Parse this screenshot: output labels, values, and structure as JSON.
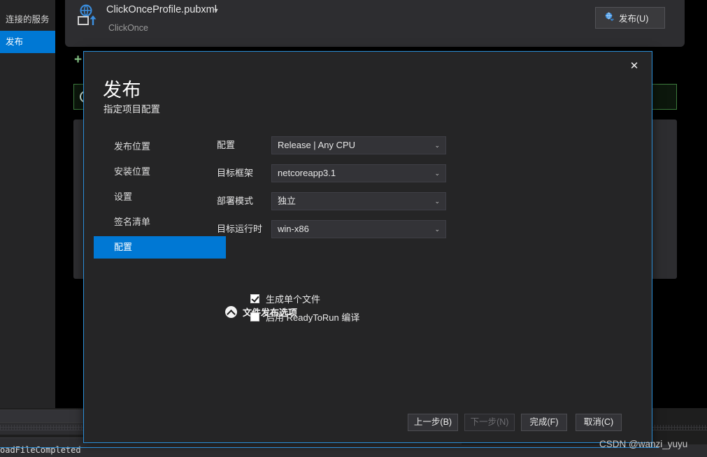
{
  "sidebar": {
    "items": [
      {
        "label": "连接的服务",
        "selected": false
      },
      {
        "label": "发布",
        "selected": true
      }
    ]
  },
  "toolbar": {
    "profile_name": "ClickOnceProfile.pubxml",
    "profile_type": "ClickOnce",
    "caret_glyph": "▼",
    "publish_button": "发布(U)"
  },
  "dialog": {
    "title": "发布",
    "subtitle": "指定项目配置",
    "close_glyph": "✕",
    "steps": [
      {
        "label": "发布位置"
      },
      {
        "label": "安装位置"
      },
      {
        "label": "设置"
      },
      {
        "label": "签名清单"
      },
      {
        "label": "配置"
      }
    ],
    "active_step_index": 4,
    "fields": [
      {
        "label": "配置",
        "value": "Release | Any CPU",
        "chevron": "⌄"
      },
      {
        "label": "目标框架",
        "value": "netcoreapp3.1",
        "chevron": "⌄"
      },
      {
        "label": "部署模式",
        "value": "独立",
        "chevron": "⌄"
      },
      {
        "label": "目标运行时",
        "value": "win-x86",
        "chevron": "⌄"
      }
    ],
    "expander": {
      "label": "文件发布选项",
      "expanded": true
    },
    "checkboxes": [
      {
        "label": "生成单个文件",
        "checked": true
      },
      {
        "label": "启用 ReadyToRun 编译",
        "checked": false
      }
    ],
    "buttons": [
      {
        "label": "上一步(B)",
        "disabled": false
      },
      {
        "label": "下一步(N)",
        "disabled": true
      },
      {
        "label": "完成(F)",
        "disabled": false
      },
      {
        "label": "取消(C)",
        "disabled": false
      }
    ]
  },
  "status": {
    "text": "oadFileCompleted"
  },
  "watermark": {
    "text": "CSDN @wanzi_yuyu"
  },
  "colors": {
    "accent_blue": "#0078d4",
    "dialog_border": "#2b8fd8",
    "panel_bg": "#252526",
    "field_bg": "#333337",
    "banner_green": "#3d7a3d"
  }
}
